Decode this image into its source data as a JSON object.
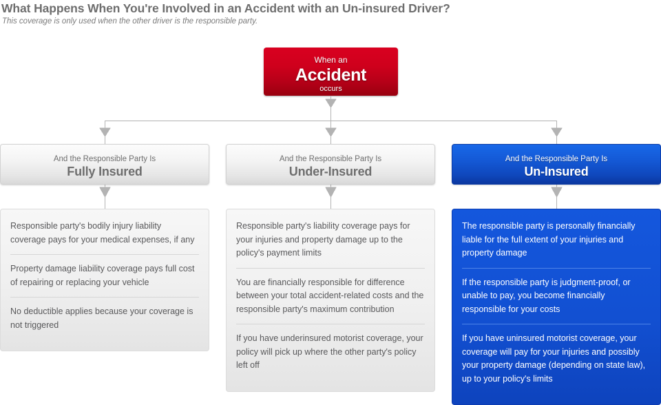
{
  "page": {
    "title": "What Happens When You're Involved in an Accident with an Un-insured Driver?",
    "subtitle": "This coverage is only used when the other driver is the responsible party."
  },
  "colors": {
    "accident_red": "#cf001c",
    "uninsured_blue": "#1459d6",
    "neutral_gray": "#e6e6e6",
    "connector_gray": "#b3b3b3",
    "title_text": "#6e6e6e",
    "body_text": "#58585a"
  },
  "root_node": {
    "line1": "When an",
    "line2": "Accident",
    "line3": "occurs"
  },
  "branches": [
    {
      "kicker": "And the Responsible Party Is",
      "title": "Fully Insured",
      "style": "gray",
      "items": [
        "Responsible party's bodily injury liability coverage pays for your medical expenses, if any",
        "Property damage liability coverage pays full cost of repairing or replacing your vehicle",
        "No deductible applies because your coverage is not triggered"
      ]
    },
    {
      "kicker": "And the Responsible Party Is",
      "title": "Under-Insured",
      "style": "gray",
      "items": [
        "Responsible party's liability coverage pays for your injuries and property damage up to the policy's payment limits",
        "You are financially responsible for difference between your total accident-related costs and the responsible party's maximum contribution",
        "If you have underinsured motorist coverage, your policy will pick up where the other party's policy left off"
      ]
    },
    {
      "kicker": "And the Responsible Party Is",
      "title": "Un-Insured",
      "style": "blue",
      "items": [
        "The responsible party is personally financially liable for the full extent of your injuries and property damage",
        "If the responsible party is judgment-proof, or unable to pay, you become financially responsible for your costs",
        "If you have uninsured motorist coverage, your coverage will pay for your injuries and possibly your property damage (depending on state law), up to your policy's limits"
      ]
    }
  ]
}
